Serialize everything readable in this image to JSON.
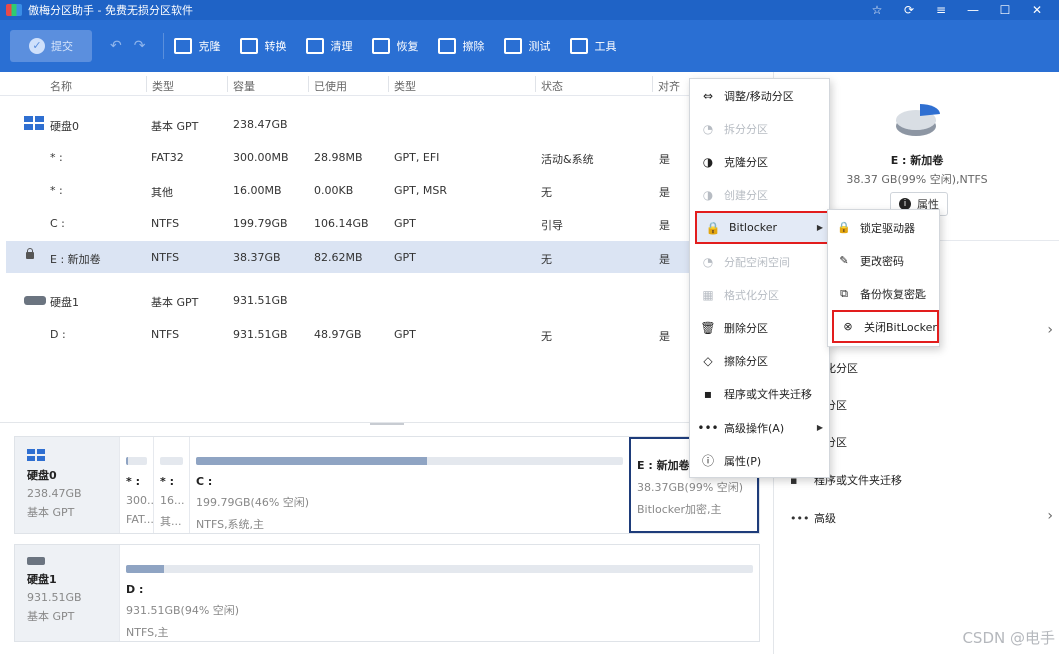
{
  "window": {
    "title": "傲梅分区助手 - 免费无损分区软件",
    "controls": [
      "☆",
      "⟳",
      "≡",
      "—",
      "☐",
      "✕"
    ]
  },
  "toolbar": {
    "submit": "提交",
    "buttons": [
      {
        "label": "克隆",
        "icon": "clone-icon"
      },
      {
        "label": "转换",
        "icon": "convert-icon"
      },
      {
        "label": "清理",
        "icon": "clean-icon"
      },
      {
        "label": "恢复",
        "icon": "recover-icon"
      },
      {
        "label": "擦除",
        "icon": "wipe-icon"
      },
      {
        "label": "测试",
        "icon": "test-icon"
      },
      {
        "label": "工具",
        "icon": "tools-icon"
      }
    ]
  },
  "table": {
    "headers": [
      "名称",
      "类型",
      "容量",
      "已使用",
      "类型",
      "状态",
      "对齐"
    ],
    "rows": [
      {
        "kind": "disk",
        "icon": "windows-disk-icon",
        "name": "硬盘0",
        "type": "基本 GPT",
        "capacity": "238.47GB",
        "used": "",
        "fs": "",
        "status": "",
        "align": ""
      },
      {
        "kind": "part",
        "name": "* :",
        "type": "FAT32",
        "capacity": "300.00MB",
        "used": "28.98MB",
        "fs": "GPT, EFI",
        "status": "活动&系统",
        "align": "是"
      },
      {
        "kind": "part",
        "name": "* :",
        "type": "其他",
        "capacity": "16.00MB",
        "used": "0.00KB",
        "fs": "GPT, MSR",
        "status": "无",
        "align": "是"
      },
      {
        "kind": "part",
        "name": "C :",
        "type": "NTFS",
        "capacity": "199.79GB",
        "used": "106.14GB",
        "fs": "GPT",
        "status": "引导",
        "align": "是"
      },
      {
        "kind": "part",
        "locked": true,
        "selected": true,
        "name": "E : 新加卷",
        "type": "NTFS",
        "capacity": "38.37GB",
        "used": "82.62MB",
        "fs": "GPT",
        "status": "无",
        "align": "是"
      },
      {
        "kind": "disk",
        "icon": "hdd-icon",
        "name": "硬盘1",
        "type": "基本 GPT",
        "capacity": "931.51GB",
        "used": "",
        "fs": "",
        "status": "",
        "align": ""
      },
      {
        "kind": "part",
        "name": "D :",
        "type": "NTFS",
        "capacity": "931.51GB",
        "used": "48.97GB",
        "fs": "GPT",
        "status": "无",
        "align": "是"
      }
    ]
  },
  "diskmap": {
    "disk0": {
      "name": "硬盘0",
      "size": "238.47GB",
      "type": "基本 GPT",
      "parts": [
        {
          "name": "* :",
          "l1": "300...",
          "l2": "FAT...",
          "fill": 0.1
        },
        {
          "name": "* :",
          "l1": "16...",
          "l2": "其...",
          "fill": 0.0
        },
        {
          "name": "C :",
          "l1": "199.79GB(46% 空闲)",
          "l2": "NTFS,系统,主",
          "fill": 0.54
        },
        {
          "name": "E : 新加卷",
          "l1": "38.37GB(99% 空闲)",
          "l2": "Bitlocker加密,主",
          "fill": 0.01
        }
      ]
    },
    "disk1": {
      "name": "硬盘1",
      "size": "931.51GB",
      "type": "基本 GPT",
      "parts": [
        {
          "name": "D :",
          "l1": "931.51GB(94% 空闲)",
          "l2": "NTFS,主",
          "fill": 0.06
        }
      ]
    }
  },
  "rpanel": {
    "name": "E : 新加卷",
    "sub": "38.37 GB(99% 空闲),NTFS",
    "props": "属性",
    "items": [
      {
        "label": "式化分区",
        "icon": "format-icon"
      },
      {
        "label": "除分区",
        "icon": "delete-icon"
      },
      {
        "label": "除分区",
        "icon": "wipe-icon"
      },
      {
        "label": "程序或文件夹迁移",
        "icon": "migrate-icon"
      },
      {
        "label": "高级",
        "icon": "more-icon"
      }
    ]
  },
  "menu": [
    {
      "label": "调整/移动分区",
      "icon": "resize-icon",
      "glyph": "⇔",
      "disabled": false
    },
    {
      "label": "拆分分区",
      "icon": "split-icon",
      "glyph": "◔",
      "disabled": true
    },
    {
      "label": "克隆分区",
      "icon": "clone-icon",
      "glyph": "◑",
      "disabled": false
    },
    {
      "label": "创建分区",
      "icon": "create-icon",
      "glyph": "◑",
      "disabled": true
    },
    {
      "label": "Bitlocker",
      "icon": "lock-icon",
      "glyph": "🔒",
      "disabled": false,
      "highlight": true,
      "sub": true
    },
    {
      "label": "分配空闲空间",
      "icon": "allocate-icon",
      "glyph": "◔",
      "disabled": true
    },
    {
      "label": "格式化分区",
      "icon": "format-icon",
      "glyph": "▦",
      "disabled": true
    },
    {
      "label": "删除分区",
      "icon": "trash-icon",
      "glyph": "🗑",
      "disabled": false
    },
    {
      "label": "擦除分区",
      "icon": "eraser-icon",
      "glyph": "◇",
      "disabled": false
    },
    {
      "label": "程序或文件夹迁移",
      "icon": "migrate-icon",
      "glyph": "▪",
      "disabled": false
    },
    {
      "label": "高级操作(A)",
      "icon": "more-icon",
      "glyph": "•••",
      "disabled": false,
      "sub": true
    },
    {
      "label": "属性(P)",
      "icon": "info-icon",
      "glyph": "ⓘ",
      "disabled": false
    }
  ],
  "submenu": [
    {
      "label": "锁定驱动器",
      "icon": "lock-icon",
      "glyph": "🔒"
    },
    {
      "label": "更改密码",
      "icon": "edit-icon",
      "glyph": "✎"
    },
    {
      "label": "备份恢复密匙",
      "icon": "copy-icon",
      "glyph": "⧉"
    },
    {
      "label": "关闭BitLocker",
      "icon": "close-circle-icon",
      "glyph": "⊗",
      "highlight": true
    }
  ],
  "watermark": "CSDN @电手"
}
